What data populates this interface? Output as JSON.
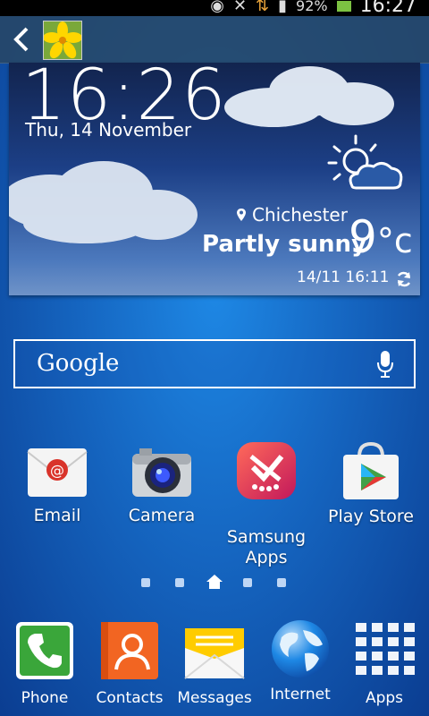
{
  "status_bar": {
    "battery": "92%",
    "time": "16:27"
  },
  "widget": {
    "time": "16:26",
    "date": "Thu, 14 November",
    "location": "Chichester",
    "condition": "Partly sunny",
    "temperature": "9",
    "temp_unit": "°c",
    "updated": "14/11 16:11"
  },
  "search": {
    "label": "Google"
  },
  "apps": [
    {
      "label": "Email"
    },
    {
      "label": "Camera"
    },
    {
      "label": "Samsung\nApps"
    },
    {
      "label": "Play Store"
    }
  ],
  "dock": [
    {
      "label": "Phone"
    },
    {
      "label": "Contacts"
    },
    {
      "label": "Messages"
    },
    {
      "label": "Internet"
    },
    {
      "label": "Apps"
    }
  ],
  "colors": {
    "battery": "#7cc242",
    "phone": "#3aa63a",
    "contacts": "#f26522",
    "messages": "#ffcc00"
  }
}
